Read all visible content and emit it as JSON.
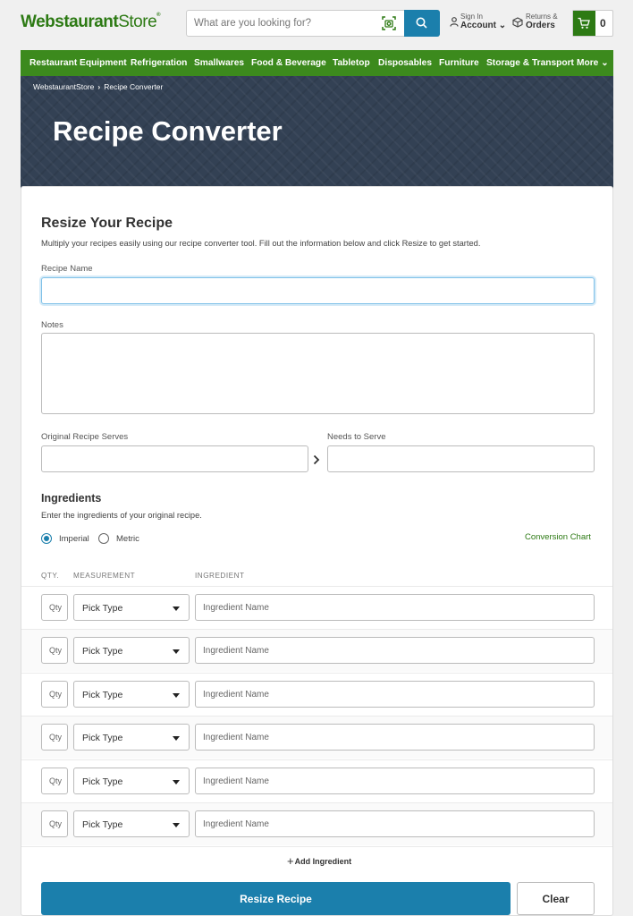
{
  "header": {
    "logo_main": "Webstaurant",
    "logo_store": "Store",
    "logo_reg": "®",
    "search_placeholder": "What are you looking for?",
    "account_line1": "Sign In",
    "account_line2": "Account",
    "orders_line1": "Returns &",
    "orders_line2": "Orders",
    "cart_count": "0"
  },
  "nav": {
    "items": [
      "Restaurant Equipment",
      "Refrigeration",
      "Smallwares",
      "Food & Beverage",
      "Tabletop",
      "Disposables",
      "Furniture",
      "Storage & Transport",
      "More"
    ]
  },
  "breadcrumb": {
    "home": "WebstaurantStore",
    "sep": "›",
    "current": "Recipe Converter"
  },
  "hero": {
    "title": "Recipe Converter"
  },
  "form": {
    "heading": "Resize Your Recipe",
    "description": "Multiply your recipes easily using our recipe converter tool. Fill out the information below and click Resize to get started.",
    "recipe_name_label": "Recipe Name",
    "recipe_name_value": "",
    "notes_label": "Notes",
    "notes_value": "",
    "original_serves_label": "Original Recipe Serves",
    "needs_serve_label": "Needs to Serve"
  },
  "ingredients": {
    "heading": "Ingredients",
    "description": "Enter the ingredients of your original recipe.",
    "units": [
      {
        "label": "Imperial",
        "selected": true
      },
      {
        "label": "Metric",
        "selected": false
      }
    ],
    "conversion_link": "Conversion Chart",
    "columns": [
      "QTY.",
      "MEASUREMENT",
      "INGREDIENT"
    ],
    "rows": [
      {
        "qty_placeholder": "Qty",
        "measurement": "Pick Type",
        "ingredient_placeholder": "Ingredient Name"
      },
      {
        "qty_placeholder": "Qty",
        "measurement": "Pick Type",
        "ingredient_placeholder": "Ingredient Name"
      },
      {
        "qty_placeholder": "Qty",
        "measurement": "Pick Type",
        "ingredient_placeholder": "Ingredient Name"
      },
      {
        "qty_placeholder": "Qty",
        "measurement": "Pick Type",
        "ingredient_placeholder": "Ingredient Name"
      },
      {
        "qty_placeholder": "Qty",
        "measurement": "Pick Type",
        "ingredient_placeholder": "Ingredient Name"
      },
      {
        "qty_placeholder": "Qty",
        "measurement": "Pick Type",
        "ingredient_placeholder": "Ingredient Name"
      }
    ],
    "add_label": "Add Ingredient"
  },
  "actions": {
    "resize_label": "Resize Recipe",
    "clear_label": "Clear"
  },
  "colors": {
    "brand_green": "#2d7a14",
    "nav_green": "#3c8a1d",
    "primary_blue": "#1b7fac",
    "hero_bg": "#334154"
  }
}
